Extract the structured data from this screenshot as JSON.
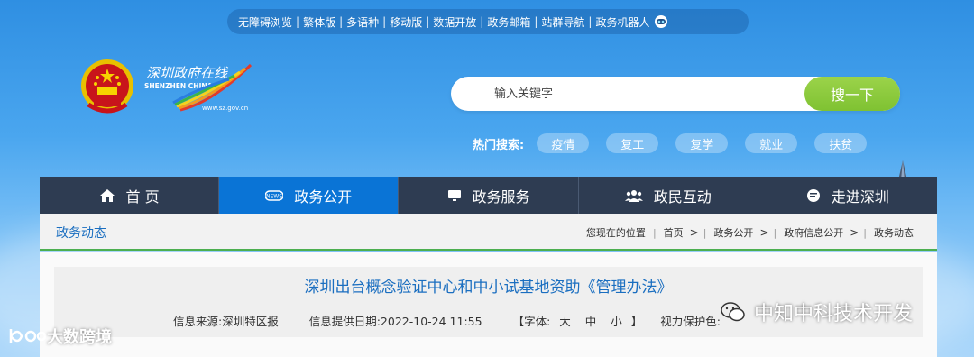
{
  "top_links": [
    "无障碍浏览",
    "繁体版",
    "多语种",
    "移动版",
    "数据开放",
    "政务邮箱",
    "站群导航",
    "政务机器人"
  ],
  "logo": {
    "cn": "深圳政府在线",
    "en": "SHENZHEN CHINA",
    "url": "www.sz.gov.cn"
  },
  "search": {
    "placeholder": "输入关键字",
    "button": "搜一下"
  },
  "hot": {
    "label": "热门搜索:",
    "tags": [
      "疫情",
      "复工",
      "复学",
      "就业",
      "扶贫"
    ]
  },
  "nav": [
    {
      "label": "首 页",
      "icon": "home-icon",
      "active": false
    },
    {
      "label": "政务公开",
      "icon": "news-icon",
      "active": true
    },
    {
      "label": "政务服务",
      "icon": "monitor-icon",
      "active": false
    },
    {
      "label": "政民互动",
      "icon": "people-icon",
      "active": false
    },
    {
      "label": "走进深圳",
      "icon": "chat-icon",
      "active": false
    }
  ],
  "section_title": "政务动态",
  "breadcrumb": {
    "prefix": "您现在的位置",
    "items": [
      "首页",
      "政务公开",
      "政府信息公开",
      "政务动态"
    ]
  },
  "article": {
    "title": "深圳出台概念验证中心和中小试基地资助《管理办法》",
    "source": "信息来源:深圳特区报",
    "date": "信息提供日期:2022-10-24 11:55",
    "font_label_open": "【字体:",
    "font_sizes": [
      "大",
      "中",
      "小"
    ],
    "font_label_close": "】",
    "vision": "视力保护色:"
  },
  "watermarks": {
    "left": "大数跨境",
    "right": "中知中科技术开发"
  },
  "colors": {
    "nav_bg": "#2e3c52",
    "nav_active": "#0a74d6",
    "search_btn": "#8cc63f",
    "link_blue": "#1a6ec0",
    "accent_green": "#4caf50"
  }
}
